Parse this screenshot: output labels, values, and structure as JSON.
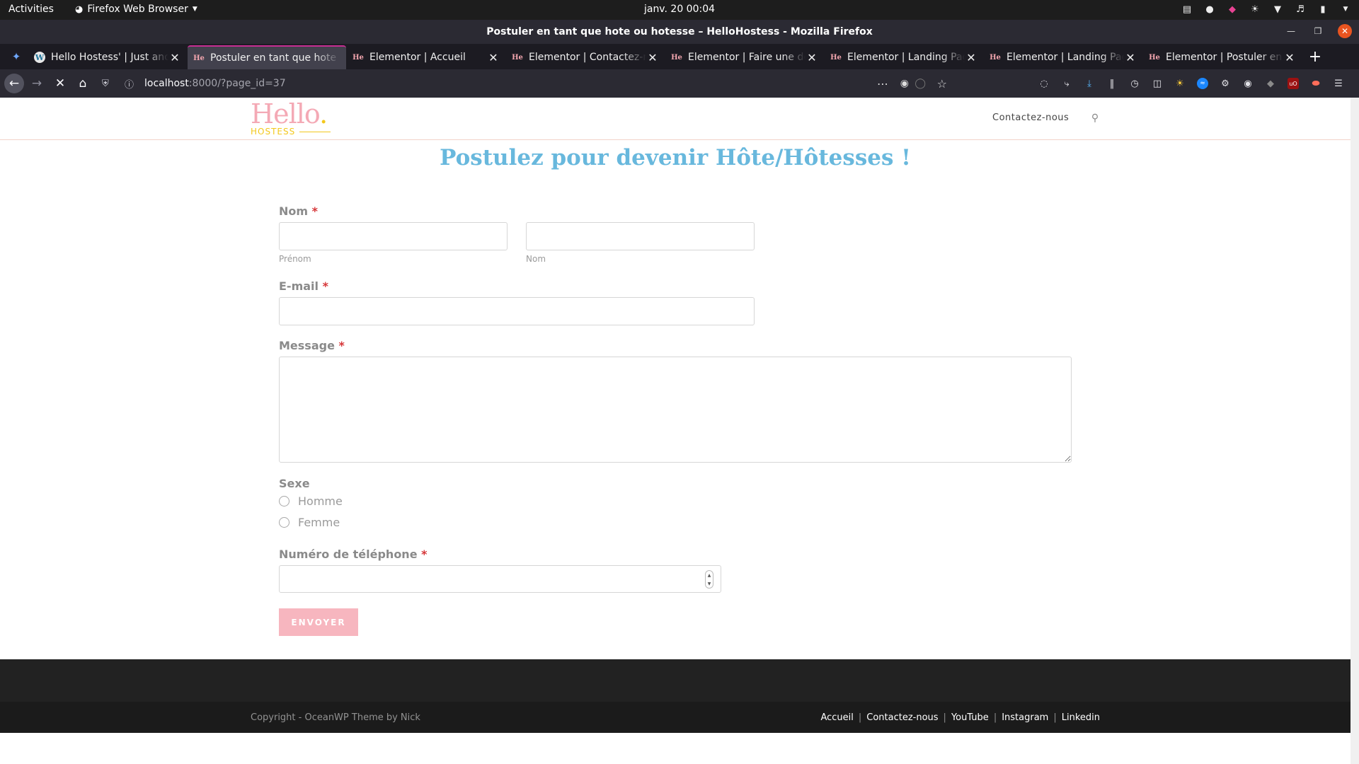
{
  "topbar": {
    "activities": "Activities",
    "app_menu": "Firefox Web Browser",
    "datetime": "janv. 20  00:04"
  },
  "window": {
    "title": "Postuler en tant que hote ou hotesse – HelloHostess - Mozilla Firefox"
  },
  "tabs": [
    {
      "label": "Hello Hostess' | Just another",
      "favicon": "wordpress-icon",
      "active": false
    },
    {
      "label": "Postuler en tant que hote ou hotesse",
      "favicon": "He",
      "active": true
    },
    {
      "label": "Elementor | Accueil",
      "favicon": "He",
      "active": false
    },
    {
      "label": "Elementor | Contactez-nous",
      "favicon": "He",
      "active": false
    },
    {
      "label": "Elementor | Faire une demande",
      "favicon": "He",
      "active": false
    },
    {
      "label": "Elementor | Landing Page",
      "favicon": "He",
      "active": false
    },
    {
      "label": "Elementor | Landing Page",
      "favicon": "He",
      "active": false
    },
    {
      "label": "Elementor | Postuler en tant que",
      "favicon": "He",
      "active": false
    }
  ],
  "urlbar": {
    "host": "localhost",
    "rest": ":8000/?page_id=37"
  },
  "site": {
    "logo_main": "Hello",
    "logo_dot": ".",
    "logo_sub": "HOSTESS",
    "menu_contact": "Contactez-nous"
  },
  "form": {
    "title": "Postulez pour devenir Hôte/Hôtesses !",
    "name_label": "Nom",
    "required_mark": "*",
    "first_name_sublabel": "Prénom",
    "last_name_sublabel": "Nom",
    "email_label": "E-mail",
    "message_label": "Message",
    "sex_label": "Sexe",
    "sex_options": [
      "Homme",
      "Femme"
    ],
    "phone_label": "Numéro de téléphone",
    "submit_label": "ENVOYER",
    "first_name_value": "",
    "last_name_value": "",
    "email_value": "",
    "message_value": "",
    "phone_value": ""
  },
  "footer": {
    "copyright": "Copyright - OceanWP Theme by Nick",
    "links": [
      "Accueil",
      "Contactez-nous",
      "YouTube",
      "Instagram",
      "Linkedin"
    ],
    "separator": "|"
  },
  "colors": {
    "accent_tab": "#c62d92",
    "title_blue": "#68b8dd",
    "logo_pink": "#f4a9b5",
    "logo_yellow": "#f3c81c",
    "submit_pink": "#f7b6bf"
  }
}
